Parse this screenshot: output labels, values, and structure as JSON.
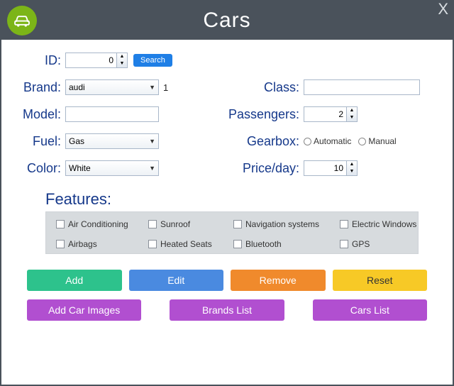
{
  "header": {
    "title": "Cars",
    "close": "X"
  },
  "labels": {
    "id": "ID:",
    "brand": "Brand:",
    "model": "Model:",
    "fuel": "Fuel:",
    "color": "Color:",
    "class": "Class:",
    "passengers": "Passengers:",
    "gearbox": "Gearbox:",
    "price": "Price/day:",
    "features": "Features:"
  },
  "fields": {
    "id": "0",
    "brand": "audi",
    "brand_count": "1",
    "model": "",
    "fuel": "Gas",
    "color": "White",
    "class": "",
    "passengers": "2",
    "price": "10"
  },
  "buttons": {
    "search": "Search",
    "add": "Add",
    "edit": "Edit",
    "remove": "Remove",
    "reset": "Reset",
    "add_images": "Add Car Images",
    "brands_list": "Brands List",
    "cars_list": "Cars List"
  },
  "gearbox": {
    "automatic": "Automatic",
    "manual": "Manual"
  },
  "features": {
    "ac": "Air Conditioning",
    "sunroof": "Sunroof",
    "nav": "Navigation systems",
    "ewin": "Electric Windows",
    "airbags": "Airbags",
    "heated": "Heated Seats",
    "bt": "Bluetooth",
    "gps": "GPS"
  }
}
